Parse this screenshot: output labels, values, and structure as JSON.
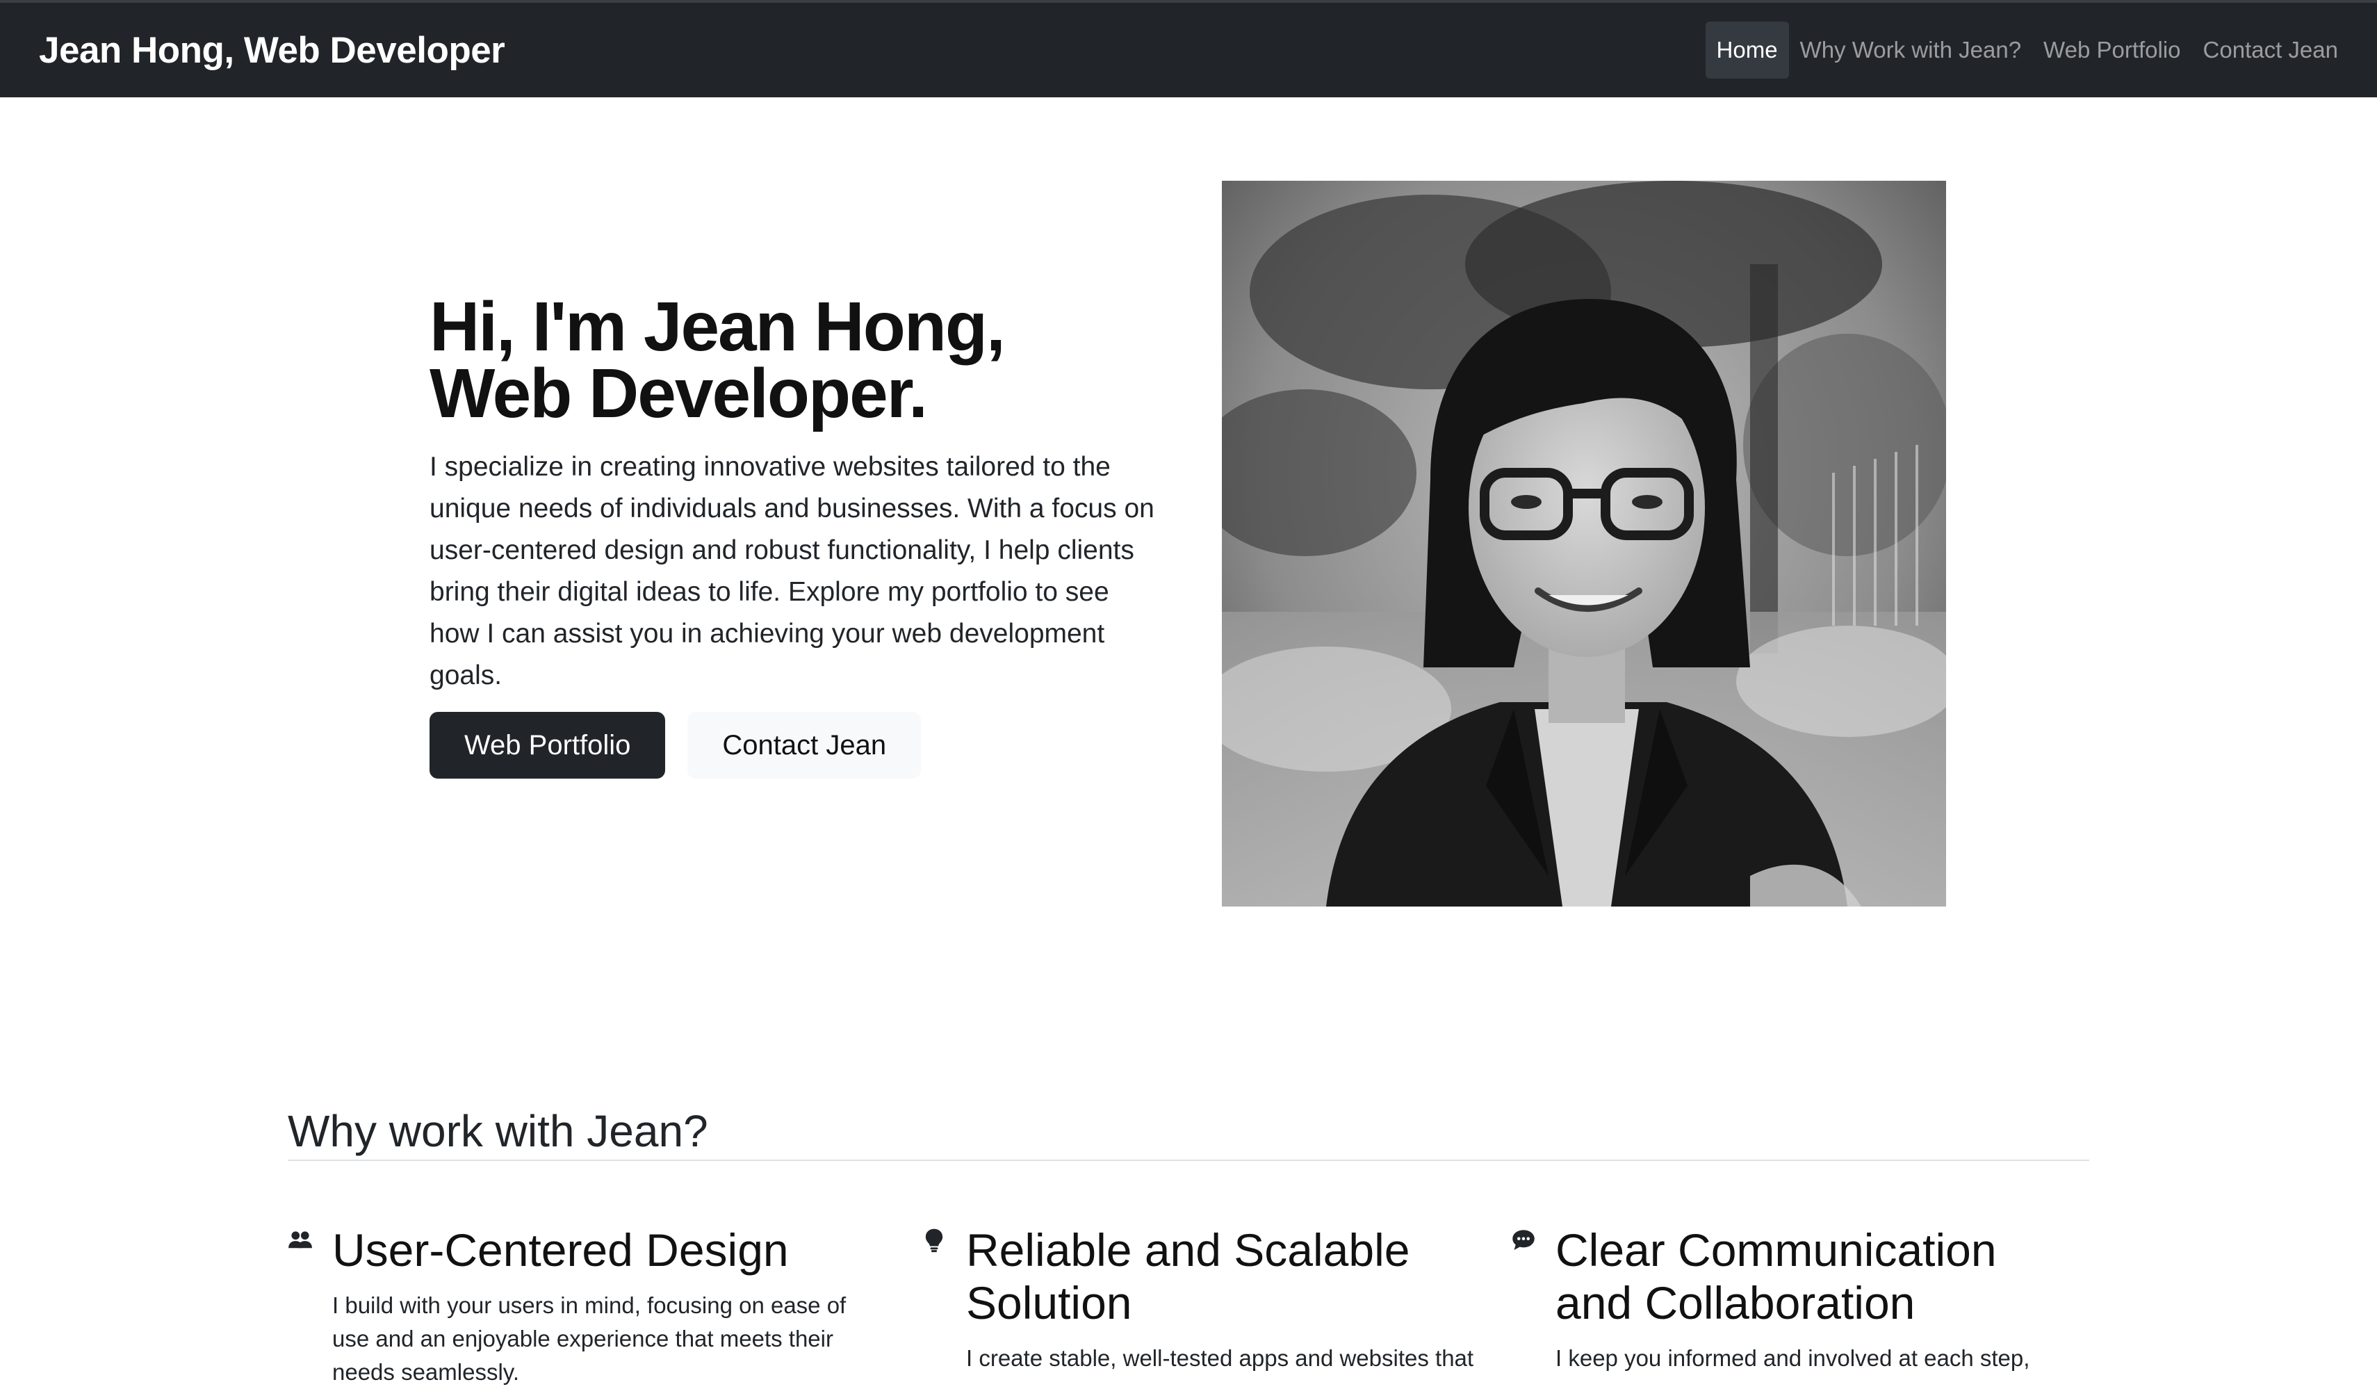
{
  "navbar": {
    "brand": "Jean Hong, Web Developer",
    "links": [
      {
        "label": "Home",
        "active": true
      },
      {
        "label": "Why Work with Jean?",
        "active": false
      },
      {
        "label": "Web Portfolio",
        "active": false
      },
      {
        "label": "Contact Jean",
        "active": false
      }
    ]
  },
  "hero": {
    "title_line1": "Hi, I'm Jean Hong,",
    "title_line2": "Web Developer.",
    "description": "I specialize in creating innovative websites tailored to the unique needs of individuals and businesses. With a focus on user-centered design and robust functionality, I help clients bring their digital ideas to life. Explore my portfolio to see how I can assist you in achieving your web development goals.",
    "primary_button": "Web Portfolio",
    "secondary_button": "Contact Jean"
  },
  "features": {
    "heading": "Why work with Jean?",
    "items": [
      {
        "icon": "people-icon",
        "title": "User-Centered Design",
        "description": "I build with your users in mind, focusing on ease of use and an enjoyable experience that meets their needs seamlessly."
      },
      {
        "icon": "lightbulb-icon",
        "title": "Reliable and Scalable Solution",
        "description": "I create stable, well-tested apps and websites that"
      },
      {
        "icon": "chat-icon",
        "title": "Clear Communication and Collaboration",
        "description": "I keep you informed and involved at each step,"
      }
    ]
  },
  "colors": {
    "navbar_bg": "#212529",
    "primary_button_bg": "#212529",
    "secondary_button_bg": "#f8f9fa"
  }
}
